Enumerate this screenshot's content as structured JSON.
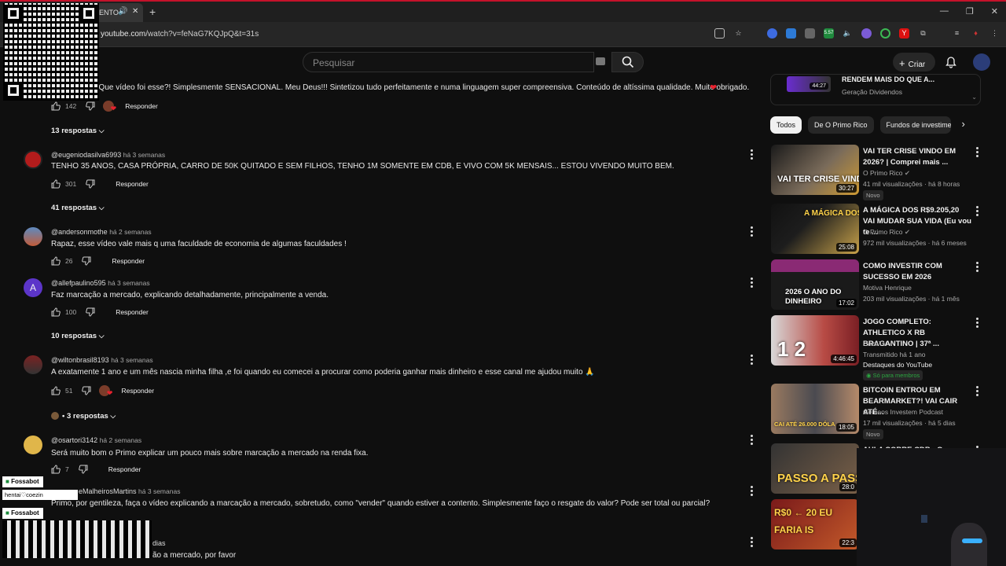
{
  "browser": {
    "tab_title": "ENTO",
    "url_domain": "youtube.com",
    "url_path": "/watch?v=feNaG7KQJpQ&t=31s",
    "ext_badge": "5.57"
  },
  "header": {
    "search_placeholder": "Pesquisar",
    "create_label": "Criar"
  },
  "comments": [
    {
      "handle": "",
      "time": "",
      "text": ". Que vídeo foi esse?! Simplesmente SENSACIONAL. Meu Deus!!! Sintetizou tudo perfeitamente e numa linguagem super compreensiva. Conteúdo de altíssima qualidade. Muito obrigado.",
      "likes": "142",
      "replies": "13 respostas"
    },
    {
      "handle": "@eugeniodasilva6993",
      "time": "há 3 semanas",
      "text": "TENHO 35 ANOS, CASA PRÓPRIA,  CARRO DE 50K QUITADO E SEM FILHOS, TENHO 1M  SOMENTE EM CDB, E VIVO COM 5K MENSAIS... ESTOU VIVENDO MUITO BEM.",
      "likes": "301",
      "replies": "41 respostas"
    },
    {
      "handle": "@andersonmothe",
      "time": "há 2 semanas",
      "text": "Rapaz, esse vídeo vale mais q uma faculdade de economia de algumas faculdades !",
      "likes": "26",
      "replies": ""
    },
    {
      "handle": "@allefpaulino595",
      "time": "há 3 semanas",
      "text": "Faz marcação a mercado, explicando detalhadamente, principalmente a venda.",
      "likes": "100",
      "replies": "10 respostas"
    },
    {
      "handle": "@wiltonbrasil8193",
      "time": "há 3 semanas",
      "text": "A exatamente 1 ano e um mês nascia minha filha ,e foi quando eu comecei a procurar como poderia ganhar mais dinheiro e esse canal me ajudou muito 🙏",
      "likes": "51",
      "replies": "• 3 respostas"
    },
    {
      "handle": "@osartori3142",
      "time": "há 2 semanas",
      "text": "Será muito bom o Primo explicar um pouco mais sobre marcação a mercado na renda fixa.",
      "likes": "7",
      "replies": ""
    },
    {
      "handle": "eMalheirosMartins",
      "time": "há 3 semanas",
      "text": "Primo, por gentileza, faça o vídeo explicando a marcação a mercado, sobretudo, como \"vender\" quando estiver a contento. Simplesmente faço o resgate do valor? Pode ser total ou parcial?",
      "likes": "",
      "replies": ""
    },
    {
      "handle": "",
      "time": "dias",
      "text": "ão a mercado, por favor",
      "likes": "",
      "replies": ""
    }
  ],
  "reply_label": "Responder",
  "sidebar": {
    "top_card": {
      "title": "RENDEM MAIS DO QUE A...",
      "channel": "Geração Dividendos",
      "duration": "44:27"
    },
    "chips": [
      "Todos",
      "De O Primo Rico",
      "Fundos de investime"
    ],
    "videos": [
      {
        "title": "VAI TER CRISE VINDO EM 2026? | Comprei mais ...",
        "channel": "O Primo Rico",
        "meta": "41 mil visualizações · há 8 horas",
        "badge": "Novo",
        "duration": "30:27",
        "thumb_text": "VAI TER CRISE VINDO AI"
      },
      {
        "title": "A MÁGICA DOS R$9.205,20 VAI MUDAR SUA VIDA (Eu vou te ...",
        "channel": "O Primo Rico",
        "meta": "972 mil visualizações · há 6 meses",
        "badge": "",
        "duration": "25:08",
        "thumb_text": "A MÁGICA DOS R$9.205,20"
      },
      {
        "title": "COMO INVESTIR COM SUCESSO EM 2026",
        "channel": "Motiva Henrique",
        "meta": "203 mil visualizações · há 1 mês",
        "badge": "",
        "duration": "17:02",
        "thumb_text": "2026 O ANO DO DINHEIRO"
      },
      {
        "title": "JOGO COMPLETO: ATHLETICO X RB BRAGANTINO | 37ª ...",
        "channel": "CazéTV",
        "meta": "Transmitido há 1 ano",
        "extra": "Destaques do YouTube",
        "badge": "Só para membros",
        "duration": "4:46:45",
        "thumb_text": "1 2"
      },
      {
        "title": "BITCOIN ENTROU EM BEARMARKET?! VAI CAIR ATÉ...",
        "channel": "Gêmeos Investem Podcast",
        "meta": "17 mil visualizações · há 5 dias",
        "badge": "Novo",
        "duration": "18:05",
        "thumb_text": "CAI ATÉ 26.000 DÓLA"
      },
      {
        "title": "AULA SOBRE CDB - O",
        "channel": "",
        "meta": "",
        "badge": "",
        "duration": "28:0",
        "thumb_text": "PASSO A PASS"
      },
      {
        "title": "",
        "channel": "",
        "meta": "",
        "badge": "",
        "duration": "22:3",
        "thumb_text": "R$0 ← 20 EU FARIA IS"
      }
    ]
  },
  "overlays": {
    "bot1": "Fossabot",
    "user1": "hentai♡coezin",
    "bot2": "Fossabot"
  }
}
